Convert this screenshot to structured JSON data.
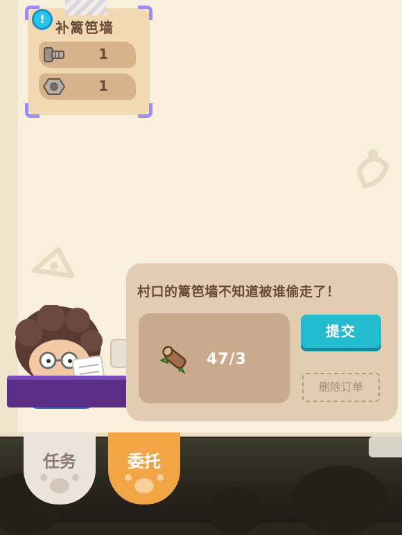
{
  "order_card": {
    "title": "补篱笆墙",
    "alert_icon": "exclamation-icon",
    "requirements": [
      {
        "icon": "bolt-icon",
        "quantity": "1"
      },
      {
        "icon": "nut-icon",
        "quantity": "1"
      }
    ]
  },
  "dialog": {
    "message": "村口的篱笆墙不知道被谁偷走了！",
    "item": {
      "icon": "wood-log-icon",
      "count": "47/3"
    },
    "submit_label": "提交",
    "delete_label": "删除订单"
  },
  "tabs": [
    {
      "label": "任务",
      "active": false
    },
    {
      "label": "委托",
      "active": true
    }
  ],
  "colors": {
    "panel_bg": "#f8f0dc",
    "card_bg": "#f1d9b3",
    "accent_purple": "#9d8cf2",
    "submit_teal": "#23bccf",
    "active_tab": "#f1a545",
    "text_brown": "#6b4a36"
  }
}
